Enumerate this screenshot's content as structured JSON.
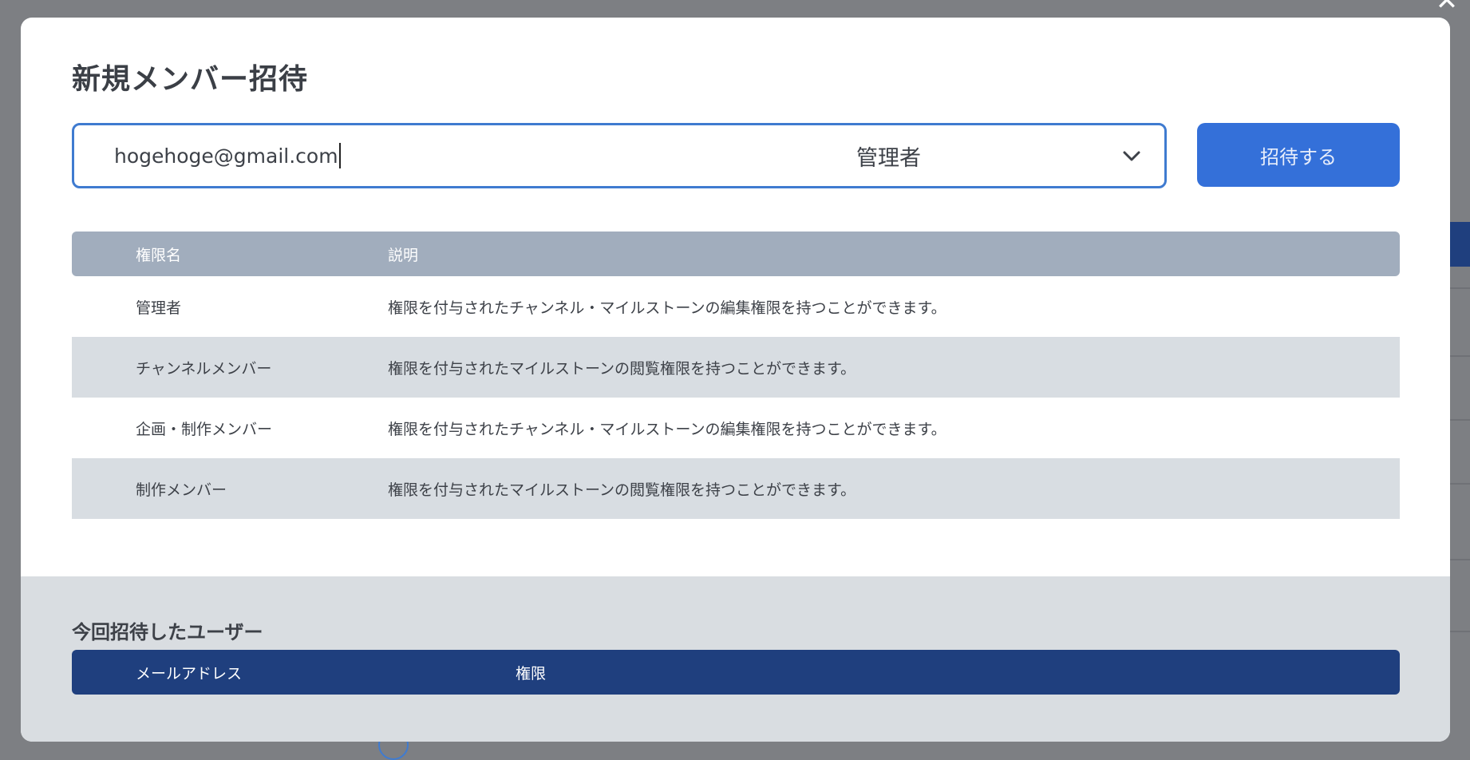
{
  "modal": {
    "title": "新規メンバー招待",
    "close_icon": "close-icon"
  },
  "invite_form": {
    "email_value": "hogehoge@gmail.com",
    "role_selected": "管理者",
    "submit_label": "招待する"
  },
  "permissions_table": {
    "headers": {
      "name": "権限名",
      "description": "説明"
    },
    "rows": [
      {
        "name": "管理者",
        "description": "権限を付与されたチャンネル・マイルストーンの編集権限を持つことができます。"
      },
      {
        "name": "チャンネルメンバー",
        "description": "権限を付与されたマイルストーンの閲覧権限を持つことができます。"
      },
      {
        "name": "企画・制作メンバー",
        "description": "権限を付与されたチャンネル・マイルストーンの編集権限を持つことができます。"
      },
      {
        "name": "制作メンバー",
        "description": "権限を付与されたマイルストーンの閲覧権限を持つことができます。"
      }
    ]
  },
  "invited_users": {
    "title": "今回招待したユーザー",
    "headers": {
      "email": "メールアドレス",
      "role": "権限"
    }
  },
  "colors": {
    "accent": "#3470d9",
    "navy": "#1f3f7e",
    "table_header": "#a1adbd",
    "row_alt": "#d8dde2",
    "overlay": "#7d7f83"
  }
}
